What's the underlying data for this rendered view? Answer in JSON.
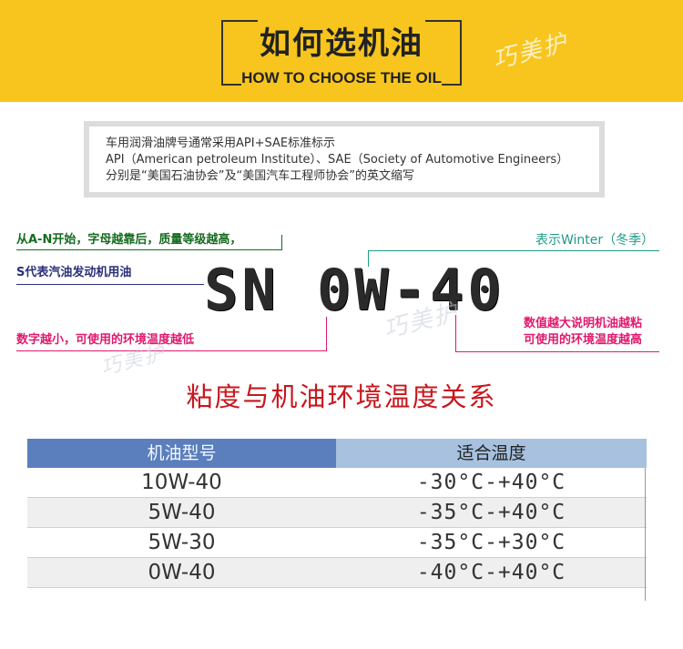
{
  "header": {
    "title": "如何选机油",
    "subtitle": "HOW TO CHOOSE THE OIL",
    "watermark": "巧美护"
  },
  "intro": {
    "lines": [
      "车用润滑油牌号通常采用API+SAE标准标示",
      "API（American petroleum Institute）、SAE（Society of Automotive Engineers）",
      "分别是“美国石油协会”及“美国汽车工程师协会”的英文缩写"
    ]
  },
  "code": {
    "value": "SN 0W-40",
    "annotations": {
      "grade": "从A-N开始，字母越靠后，质量等级越高，",
      "gasoline": "S代表汽油发动机用油",
      "low_temp": "数字越小，可使用的环境温度越低",
      "winter": "表示Winter（冬季）",
      "viscosity_line1": "数值越大说明机油越粘",
      "viscosity_line2": "可使用的环境温度越高"
    },
    "colors": {
      "green": "#166b1f",
      "navy": "#2b2f7a",
      "pink": "#e0196e",
      "teal": "#1e9a88"
    }
  },
  "table": {
    "title": "粘度与机油环境温度关系",
    "headers": [
      "机油型号",
      "适合温度"
    ],
    "rows": [
      [
        "10W-40",
        "-30°C-+40°C"
      ],
      [
        "5W-40",
        "-35°C-+40°C"
      ],
      [
        "5W-30",
        "-35°C-+30°C"
      ],
      [
        "0W-40",
        "-40°C-+40°C"
      ]
    ],
    "colors": {
      "header_left": "#5b7fbd",
      "header_right": "#a7c1df",
      "title": "#c8161d"
    }
  },
  "theme": {
    "banner": "#f7c51d"
  }
}
